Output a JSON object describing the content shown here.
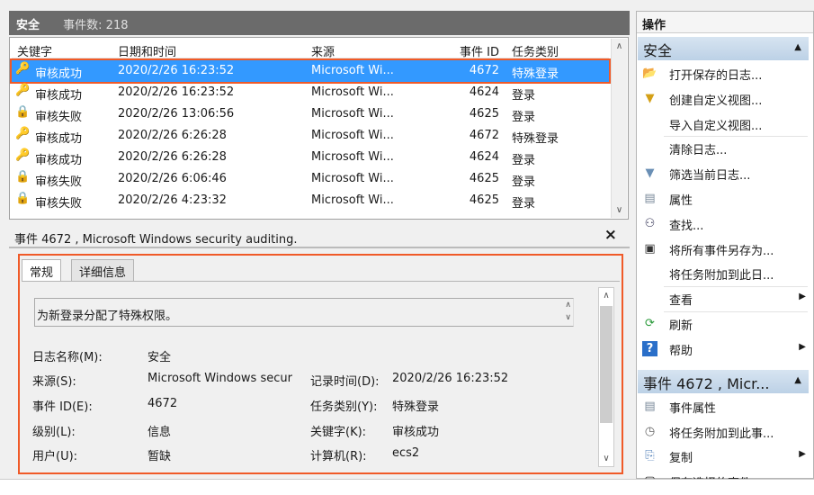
{
  "header": {
    "log": "安全",
    "count": "事件数: 218"
  },
  "columns": [
    "关键字",
    "日期和时间",
    "来源",
    "事件 ID",
    "任务类别"
  ],
  "rows": [
    {
      "keyword": "审核成功",
      "date": "2020/2/26 16:23:52",
      "source": "Microsoft Wi...",
      "id": "4672",
      "cat": "特殊登录",
      "icon": "key-icon"
    },
    {
      "keyword": "审核成功",
      "date": "2020/2/26 16:23:52",
      "source": "Microsoft Wi...",
      "id": "4624",
      "cat": "登录",
      "icon": "key-icon"
    },
    {
      "keyword": "审核失败",
      "date": "2020/2/26 13:06:56",
      "source": "Microsoft Wi...",
      "id": "4625",
      "cat": "登录",
      "icon": "lock-icon"
    },
    {
      "keyword": "审核成功",
      "date": "2020/2/26 6:26:28",
      "source": "Microsoft Wi...",
      "id": "4672",
      "cat": "特殊登录",
      "icon": "key-icon"
    },
    {
      "keyword": "审核成功",
      "date": "2020/2/26 6:26:28",
      "source": "Microsoft Wi...",
      "id": "4624",
      "cat": "登录",
      "icon": "key-icon"
    },
    {
      "keyword": "审核失败",
      "date": "2020/2/26 6:06:46",
      "source": "Microsoft Wi...",
      "id": "4625",
      "cat": "登录",
      "icon": "lock-icon"
    },
    {
      "keyword": "审核失败",
      "date": "2020/2/26 4:23:32",
      "source": "Microsoft Wi...",
      "id": "4625",
      "cat": "登录",
      "icon": "lock-icon"
    }
  ],
  "detail": {
    "title": "事件 4672 , Microsoft Windows security auditing.",
    "close": "×",
    "tabs": [
      "常规",
      "详细信息"
    ],
    "message": "为新登录分配了特殊权限。",
    "fields": {
      "log_name_label": "日志名称(M):",
      "log_name": "安全",
      "source_label": "来源(S):",
      "source": "Microsoft Windows secur",
      "logged_label": "记录时间(D):",
      "logged": "2020/2/26 16:23:52",
      "id_label": "事件 ID(E):",
      "id": "4672",
      "cat_label": "任务类别(Y):",
      "cat": "特殊登录",
      "level_label": "级别(L):",
      "level": "信息",
      "kw_label": "关键字(K):",
      "kw": "审核成功",
      "user_label": "用户(U):",
      "user": "暂缺",
      "computer_label": "计算机(R):",
      "computer": "ecs2"
    }
  },
  "actions": {
    "title": "操作",
    "sec1": "安全",
    "items1": [
      "打开保存的日志...",
      "创建自定义视图...",
      "导入自定义视图...",
      "清除日志...",
      "筛选当前日志...",
      "属性",
      "查找...",
      "将所有事件另存为...",
      "将任务附加到此日...",
      "查看",
      "刷新",
      "帮助"
    ],
    "sec2": "事件 4672 , Micr...",
    "items2": [
      "事件属性",
      "将任务附加到此事...",
      "复制",
      "保存选择的事件..."
    ]
  }
}
